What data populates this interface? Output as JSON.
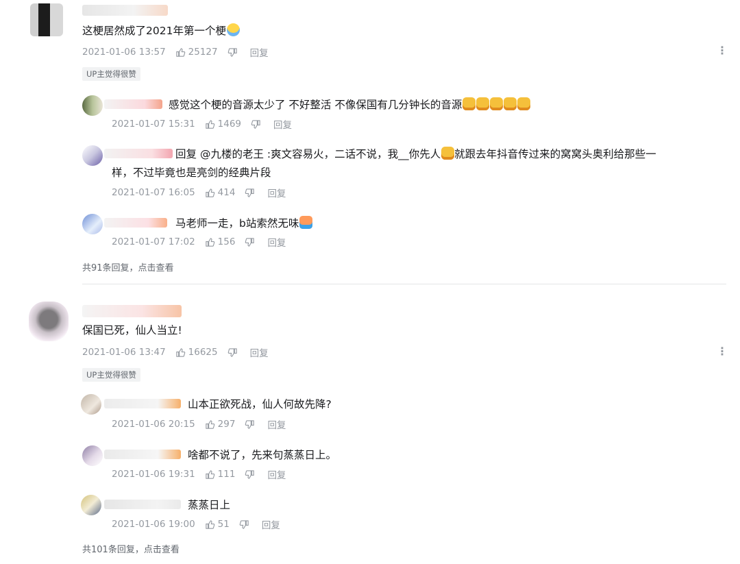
{
  "comments": [
    {
      "text": "这梗居然成了2021年第一个梗",
      "time": "2021-01-06 13:57",
      "likes": "25127",
      "reply": "回复",
      "badge": "UP主觉得很赞",
      "replies": [
        {
          "text": "感觉这个梗的音源太少了 不好整活 不像保国有几分钟长的音源",
          "time": "2021-01-07 15:31",
          "likes": "1469",
          "reply": "回复"
        },
        {
          "prefix": "回复 ",
          "mention": "@九楼的老王",
          "text_line1": " :爽文容易火，二话不说，我__你先人",
          "text_line1b": "就跟去年抖音传过来的窝窝头奥利给那些一",
          "text_line2": "样，不过毕竟也是亮剑的经典片段",
          "time": "2021-01-07 16:05",
          "likes": "414",
          "reply": "回复"
        },
        {
          "text": "马老师一走，b站索然无味",
          "time": "2021-01-07 17:02",
          "likes": "156",
          "reply": "回复"
        }
      ],
      "view_more": "共91条回复，点击查看"
    },
    {
      "text": "保国已死，仙人当立!",
      "time": "2021-01-06 13:47",
      "likes": "16625",
      "reply": "回复",
      "badge": "UP主觉得很赞",
      "replies": [
        {
          "text": "山本正欲死战，仙人何故先降?",
          "time": "2021-01-06 20:15",
          "likes": "297",
          "reply": "回复"
        },
        {
          "text": "啥都不说了，先来句蒸蒸日上。",
          "time": "2021-01-06 19:31",
          "likes": "111",
          "reply": "回复"
        },
        {
          "text": "蒸蒸日上",
          "time": "2021-01-06 19:00",
          "likes": "51",
          "reply": "回复"
        }
      ],
      "view_more": "共101条回复，点击查看"
    }
  ],
  "icons": {
    "like": "thumb-up-icon",
    "dislike": "thumb-down-icon",
    "more": "more-vertical-icon"
  },
  "colors": {
    "text": "#18191c",
    "meta": "#9499a0",
    "badge_bg": "#f1f2f3",
    "divider": "#e3e5e7"
  }
}
